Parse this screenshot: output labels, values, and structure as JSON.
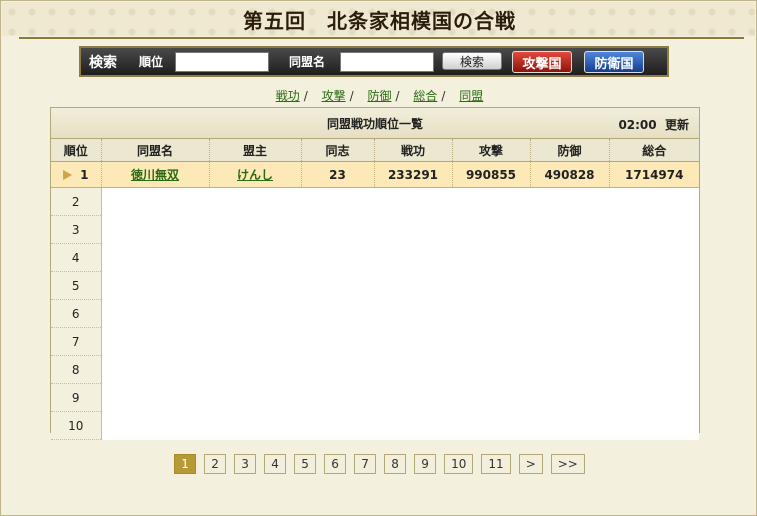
{
  "title": "第五回　北条家相模国の合戦",
  "search": {
    "label": "検索",
    "rank_label": "順位",
    "alliance_label": "同盟名",
    "rank_value": "",
    "alliance_value": "",
    "search_button": "検索",
    "attack_button": "攻撃国",
    "defense_button": "防衛国"
  },
  "categories": [
    "戦功",
    "攻撃",
    "防御",
    "総合",
    "同盟"
  ],
  "category_sep": "/",
  "table": {
    "caption": "同盟戦功順位一覧",
    "time": "02:00",
    "update": "更新",
    "headers": [
      "順位",
      "同盟名",
      "盟主",
      "同志",
      "戦功",
      "攻撃",
      "防御",
      "総合"
    ],
    "rows": [
      {
        "rank": "1",
        "alliance": "徳川無双",
        "leader": "けんし",
        "members": "23",
        "merit": "233291",
        "attack": "990855",
        "defense": "490828",
        "total": "1714974"
      }
    ],
    "empty_ranks": [
      "2",
      "3",
      "4",
      "5",
      "6",
      "7",
      "8",
      "9",
      "10"
    ]
  },
  "pagination": [
    "1",
    "2",
    "3",
    "4",
    "5",
    "6",
    "7",
    "8",
    "9",
    "10",
    "11",
    ">",
    ">>"
  ],
  "current_page": "1",
  "colors": {
    "accent": "#b79a35",
    "link": "#2a6a10",
    "attack": "#c0261a",
    "defense": "#1d4fa8",
    "highlight_row": "#fde9b8"
  }
}
